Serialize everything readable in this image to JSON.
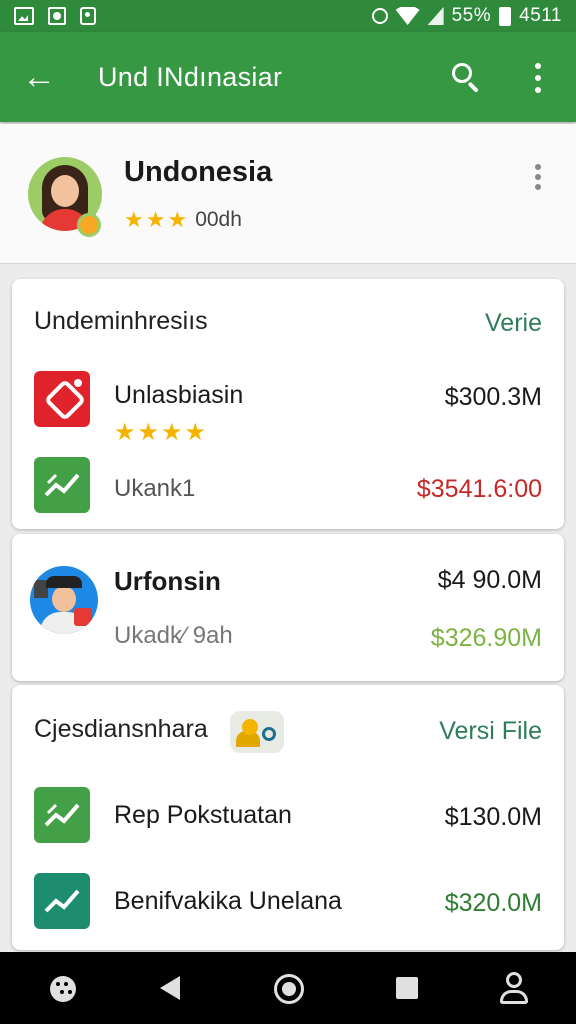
{
  "status_bar": {
    "battery": "55%",
    "time": "4511"
  },
  "app_bar": {
    "title": "Und INdınasiar"
  },
  "profile": {
    "name": "Undonesia",
    "stars": 3,
    "rating_text": "00dh"
  },
  "cards": [
    {
      "heading": "Undeminhresiıs",
      "link": "Verie",
      "items": [
        {
          "name": "Unlasbiasin",
          "price": "$300.3M",
          "stars": 4,
          "icon": "red-tag-icon"
        },
        {
          "name": "Ukank1",
          "price": "$3541.6:00",
          "icon": "green-chart-icon"
        }
      ]
    },
    {
      "title": "Urfonsin",
      "subtitle": "Ukadk⁄ 9ah",
      "price_primary": "$4 90.0M",
      "price_secondary": "$326.90M",
      "icon": "person-avatar"
    },
    {
      "heading": "Cjesdiansnhara",
      "link": "Versi File",
      "items": [
        {
          "name": "Rep Pokstuatan",
          "price": "$130.0M",
          "icon": "green-chart-icon"
        },
        {
          "name": "Benifvakika Unelana",
          "price": "$320.0M",
          "icon": "teal-chart-icon"
        }
      ]
    }
  ],
  "colors": {
    "app_bar": "#369842",
    "status_bar": "#2f8a3c",
    "price_red": "#c62828",
    "price_light_green": "#7cb342",
    "price_green": "#2e7d32",
    "link": "#2e7d5b"
  }
}
